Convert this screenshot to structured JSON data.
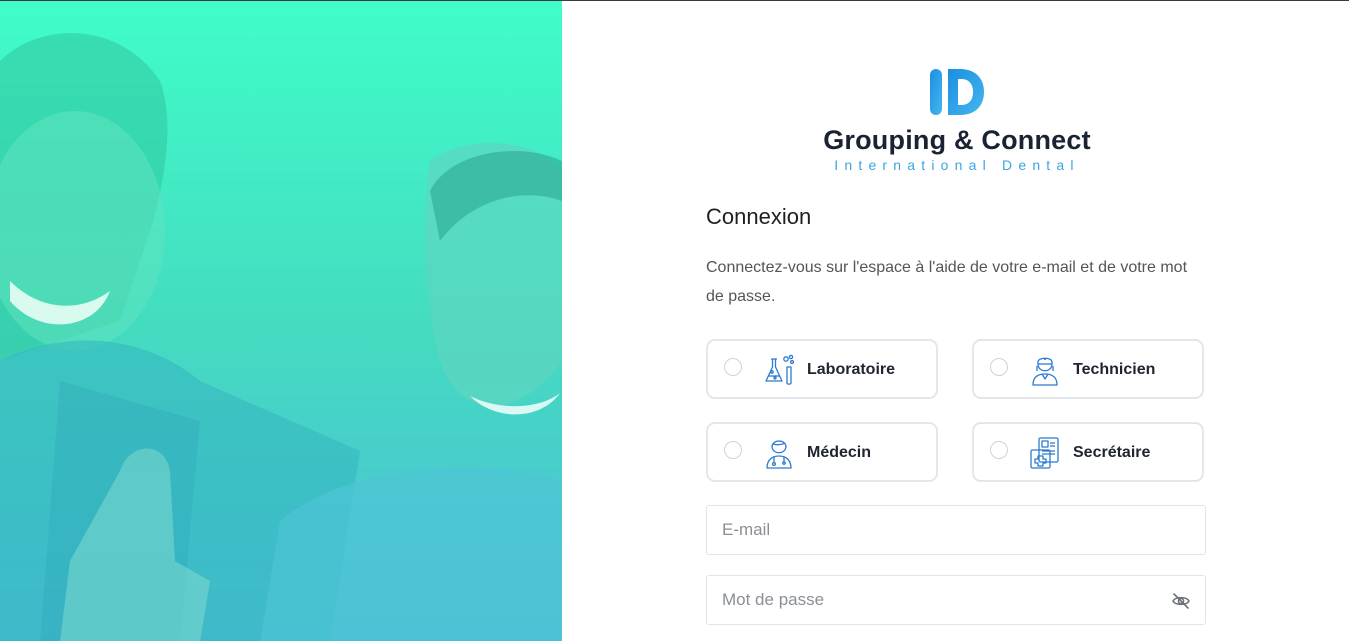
{
  "brand": {
    "mark": "ID",
    "title": "Grouping & Connect",
    "subtitle": "International Dental"
  },
  "form": {
    "title": "Connexion",
    "description": "Connectez-vous sur l'espace à l'aide de votre e-mail et de votre mot de passe.",
    "roles": [
      {
        "label": "Laboratoire",
        "icon": "flask-icon"
      },
      {
        "label": "Technicien",
        "icon": "nurse-icon"
      },
      {
        "label": "Médecin",
        "icon": "doctor-icon"
      },
      {
        "label": "Secrétaire",
        "icon": "medical-file-icon"
      }
    ],
    "email": {
      "placeholder": "E-mail",
      "value": ""
    },
    "password": {
      "placeholder": "Mot de passe",
      "value": "",
      "toggle_icon": "eye-slash-icon"
    }
  },
  "colors": {
    "hero_top": "#3ffdc9",
    "hero_bottom": "#4bbfd8",
    "accent": "#3aa6e3",
    "text_dark": "#1a2333"
  }
}
